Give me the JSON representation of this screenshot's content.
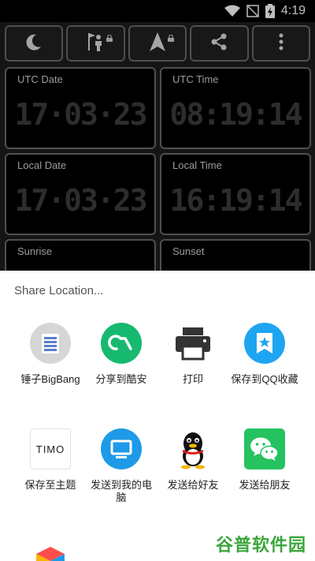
{
  "status": {
    "time": "4:19"
  },
  "tiles": [
    {
      "label": "UTC Date",
      "value": "17·03·23"
    },
    {
      "label": "UTC Time",
      "value": "08:19:14"
    },
    {
      "label": "Local Date",
      "value": "17·03·23"
    },
    {
      "label": "Local Time",
      "value": "16:19:14"
    },
    {
      "label": "Sunrise",
      "value": ""
    },
    {
      "label": "Sunset",
      "value": ""
    }
  ],
  "share": {
    "title": "Share Location...",
    "apps": [
      {
        "label": "锤子BigBang",
        "icon": "bigbang-icon"
      },
      {
        "label": "分享到酷安",
        "icon": "coolapk-icon"
      },
      {
        "label": "打印",
        "icon": "printer-icon"
      },
      {
        "label": "保存到QQ收藏",
        "icon": "qq-favorites-icon"
      },
      {
        "label": "保存至主题",
        "icon": "timo-icon",
        "icon_text": "TIMO"
      },
      {
        "label": "发送到我的电脑",
        "icon": "computer-icon"
      },
      {
        "label": "发送给好友",
        "icon": "qq-penguin-icon"
      },
      {
        "label": "发送给朋友",
        "icon": "wechat-icon"
      }
    ]
  },
  "watermark": "谷普软件园"
}
